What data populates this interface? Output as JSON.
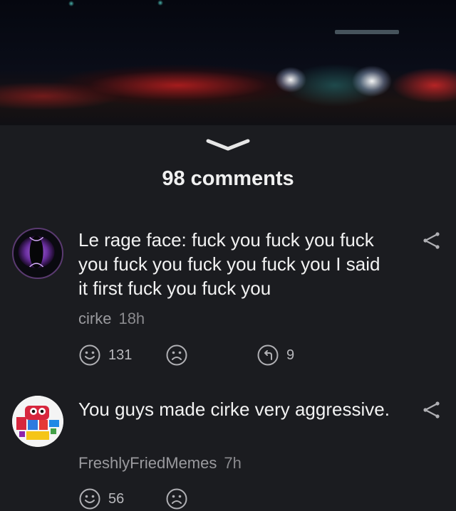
{
  "comments_header": {
    "count_label": "98 comments"
  },
  "icons": {
    "collapse": "chevron-down-icon",
    "share": "share-icon",
    "upvote": "smiley-icon",
    "downvote": "frown-icon",
    "reply": "reply-icon"
  },
  "comments": [
    {
      "text": "Le rage face: fuck you fuck you fuck you fuck you fuck you fuck you I said it first fuck you fuck you",
      "author": "cirke",
      "time": "18h",
      "upvotes": "131",
      "replies": "9"
    },
    {
      "text": "You guys made cirke very aggressive.",
      "author": "FreshlyFriedMemes",
      "time": "7h",
      "upvotes": "56"
    }
  ],
  "colors": {
    "background": "#1b1c20",
    "text": "#f2f2f2",
    "meta": "#9a9a9e",
    "icon": "#b0b0b4"
  }
}
